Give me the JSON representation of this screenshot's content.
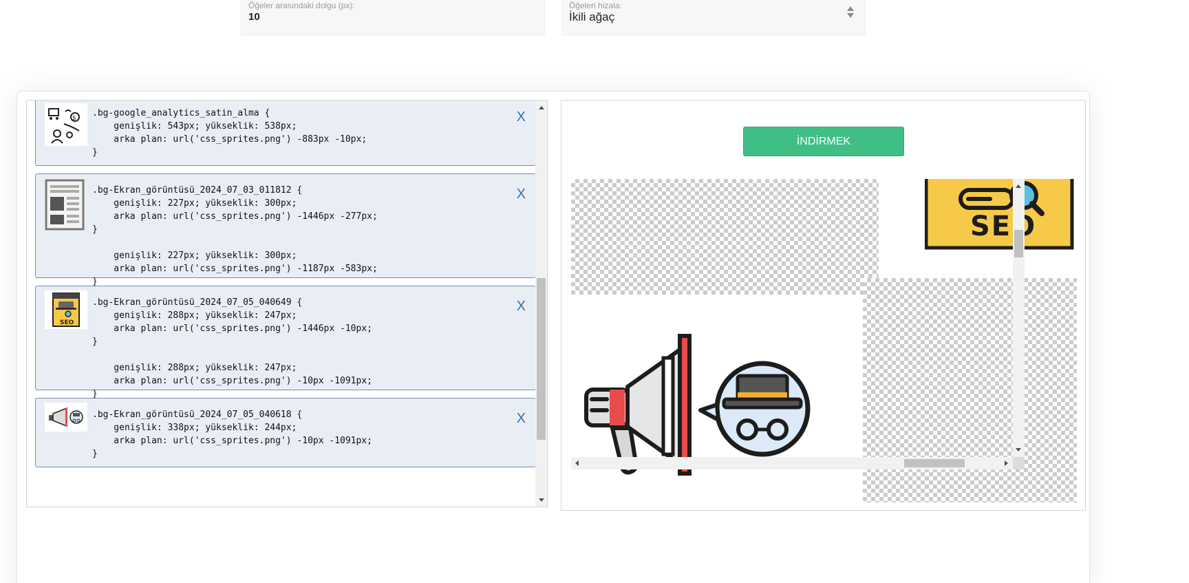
{
  "settings": {
    "padding_label": "Öğeler arasındaki dolgu (px):",
    "padding_value": "10",
    "align_label": "Öğeleri hizala:",
    "align_value": "İkili ağaç"
  },
  "entries": [
    {
      "code": ".bg-google_analytics_satin_alma {\n    genişlik: 543px; yükseklik: 538px;\n    arka plan: url('css_sprites.png') -883px -10px;\n}",
      "close": "X",
      "icon": "analytics-people-icon"
    },
    {
      "code": ".bg-Ekran_görüntüsü_2024_07_03_011812 {\n    genişlik: 227px; yükseklik: 300px;\n    arka plan: url('css_sprites.png') -1446px -277px;\n}\n\n    genişlik: 227px; yükseklik: 300px;\n    arka plan: url('css_sprites.png') -1187px -583px;\n}",
      "close": "X",
      "icon": "document-page-icon"
    },
    {
      "code": ".bg-Ekran_görüntüsü_2024_07_05_040649 {\n    genişlik: 288px; yükseklik: 247px;\n    arka plan: url('css_sprites.png') -1446px -10px;\n}\n\n    genişlik: 288px; yükseklik: 247px;\n    arka plan: url('css_sprites.png') -10px -1091px;\n}",
      "close": "X",
      "icon": "seo-hat-icon"
    },
    {
      "code": ".bg-Ekran_görüntüsü_2024_07_05_040618 {\n    genişlik: 338px; yükseklik: 244px;\n    arka plan: url('css_sprites.png') -10px -1091px;\n}",
      "close": "X",
      "icon": "megaphone-spy-icon"
    }
  ],
  "preview": {
    "download_label": "İNDİRMEK",
    "seo_text": "SEO"
  },
  "colors": {
    "accent_green": "#3fbf86",
    "entry_bg": "#e9eef5",
    "entry_border": "#6f8eae",
    "close_blue": "#3a6ea5",
    "seo_yellow": "#f7c948",
    "megaphone_red": "#e84b4b"
  }
}
